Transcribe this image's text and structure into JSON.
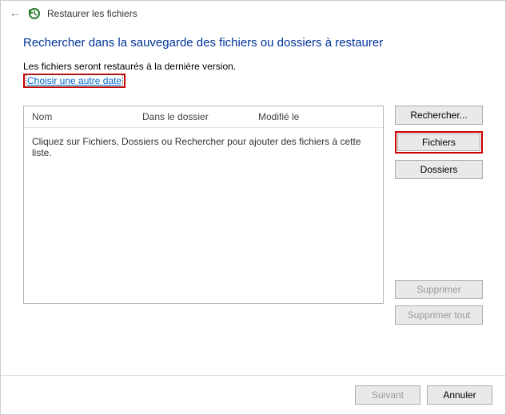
{
  "titlebar": {
    "title": "Restaurer les fichiers"
  },
  "heading": "Rechercher dans la sauvegarde des fichiers ou dossiers à restaurer",
  "subtext": "Les fichiers seront restaurés à la dernière version.",
  "link": "Choisir une autre date",
  "list": {
    "columns": {
      "name": "Nom",
      "folder": "Dans le dossier",
      "modified": "Modifié le"
    },
    "empty_text": "Cliquez sur Fichiers, Dossiers ou Rechercher pour ajouter des fichiers à cette liste."
  },
  "side": {
    "search": "Rechercher...",
    "files": "Fichiers",
    "folders": "Dossiers",
    "remove": "Supprimer",
    "remove_all": "Supprimer tout"
  },
  "footer": {
    "next": "Suivant",
    "cancel": "Annuler"
  }
}
